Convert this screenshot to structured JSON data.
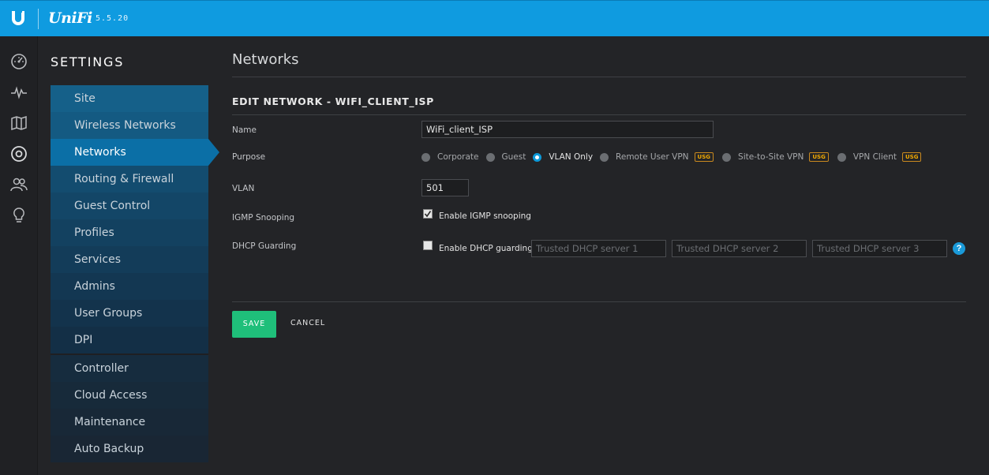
{
  "header": {
    "logo_icon": "ubiquiti-u-icon",
    "brand": "UniFi",
    "version": "5.5.20",
    "accent_color": "#0f9be0"
  },
  "rail": {
    "items": [
      {
        "name": "dashboard-icon"
      },
      {
        "name": "statistics-icon"
      },
      {
        "name": "map-icon"
      },
      {
        "name": "devices-icon"
      },
      {
        "name": "clients-icon"
      },
      {
        "name": "insights-icon"
      }
    ]
  },
  "settings": {
    "title": "SETTINGS",
    "menu": [
      {
        "label": "Site",
        "bg": "#156089"
      },
      {
        "label": "Wireless Networks",
        "bg": "#145a82"
      },
      {
        "label": "Networks",
        "bg": "#0b6fa6",
        "active": true
      },
      {
        "label": "Routing & Firewall",
        "bg": "#134c6f"
      },
      {
        "label": "Guest Control",
        "bg": "#134667"
      },
      {
        "label": "Profiles",
        "bg": "#134160"
      },
      {
        "label": "Services",
        "bg": "#133c59"
      },
      {
        "label": "Admins",
        "bg": "#133752"
      },
      {
        "label": "User Groups",
        "bg": "#13334c"
      },
      {
        "label": "DPI",
        "bg": "#132f46"
      }
    ],
    "menu2": [
      {
        "label": "Controller",
        "bg": "#162c3e"
      },
      {
        "label": "Cloud Access",
        "bg": "#172a3a"
      },
      {
        "label": "Maintenance",
        "bg": "#182837"
      },
      {
        "label": "Auto Backup",
        "bg": "#192634"
      }
    ]
  },
  "main": {
    "page_title": "Networks",
    "section_title": "EDIT NETWORK - WIFI_CLIENT_ISP",
    "name_label": "Name",
    "name_value": "WiFi_client_ISP",
    "purpose_label": "Purpose",
    "purpose_options": [
      {
        "label": "Corporate",
        "checked": false,
        "usg": ""
      },
      {
        "label": "Guest",
        "checked": false,
        "usg": ""
      },
      {
        "label": "VLAN Only",
        "checked": true,
        "usg": ""
      },
      {
        "label": "Remote User VPN",
        "checked": false,
        "usg": "USG"
      },
      {
        "label": "Site-to-Site VPN",
        "checked": false,
        "usg": "USG"
      },
      {
        "label": "VPN Client",
        "checked": false,
        "usg": "USG"
      }
    ],
    "vlan_label": "VLAN",
    "vlan_value": "501",
    "igmp_label": "IGMP Snooping",
    "igmp_checkbox_label": "Enable IGMP snooping",
    "igmp_checked": true,
    "dhcp_label": "DHCP Guarding",
    "dhcp_checkbox_label": "Enable DHCP guarding",
    "dhcp_checked": false,
    "dhcp_server1_placeholder": "Trusted DHCP server 1",
    "dhcp_server2_placeholder": "Trusted DHCP server 2",
    "dhcp_server3_placeholder": "Trusted DHCP server 3",
    "help_icon": "help-icon",
    "save_label": "SAVE",
    "cancel_label": "CANCEL",
    "save_color": "#1fbf7a"
  }
}
